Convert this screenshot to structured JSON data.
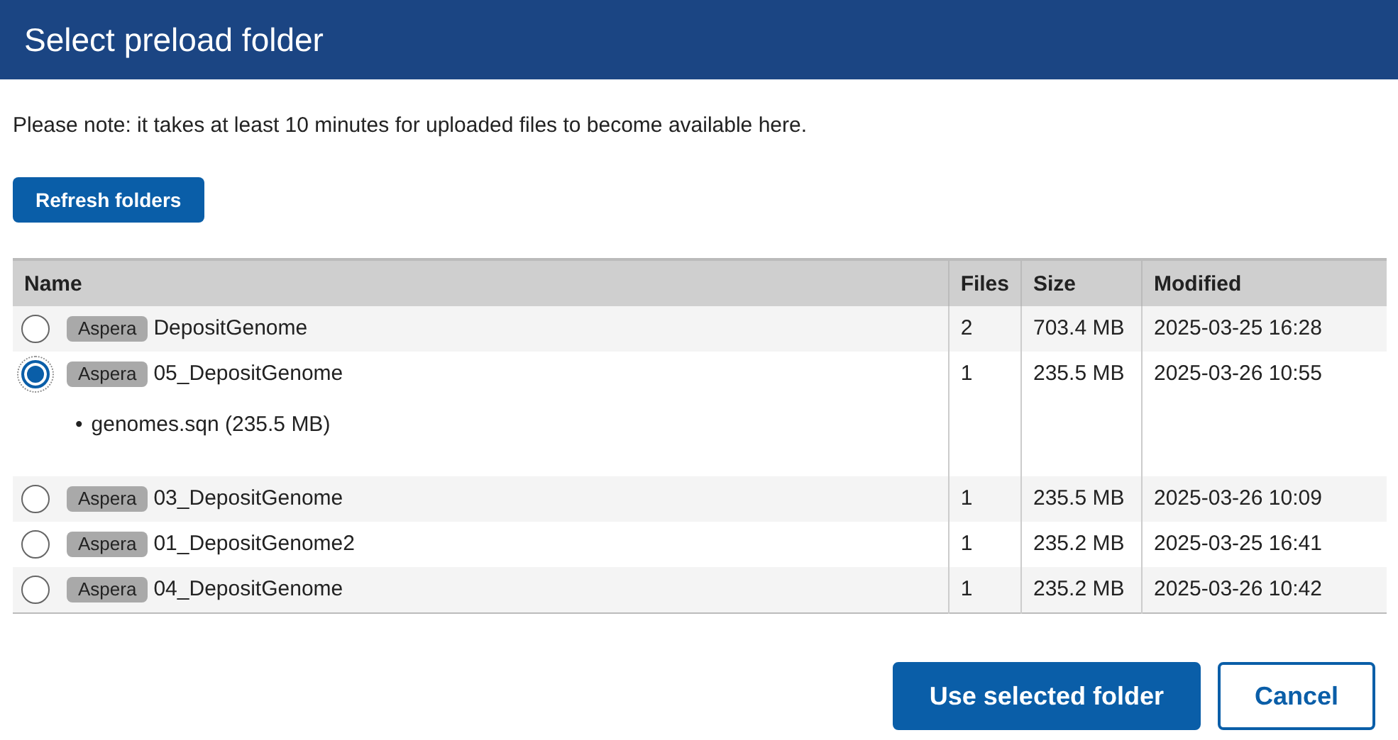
{
  "window": {
    "title": "Select preload folder"
  },
  "note": "Please note: it takes at least 10 minutes for uploaded files to become available here.",
  "refresh_button": "Refresh folders",
  "table": {
    "columns": [
      "Name",
      "Files",
      "Size",
      "Modified"
    ],
    "rows": [
      {
        "selected": false,
        "tag": "Aspera",
        "name": "DepositGenome",
        "files": "2",
        "size": "703.4 MB",
        "modified": "2025-03-25 16:28",
        "children": []
      },
      {
        "selected": true,
        "tag": "Aspera",
        "name": "05_DepositGenome",
        "files": "1",
        "size": "235.5 MB",
        "modified": "2025-03-26 10:55",
        "children": [
          {
            "marker": "•",
            "text": "genomes.sqn (235.5 MB)"
          }
        ]
      },
      {
        "selected": false,
        "tag": "Aspera",
        "name": "03_DepositGenome",
        "files": "1",
        "size": "235.5 MB",
        "modified": "2025-03-26 10:09",
        "children": []
      },
      {
        "selected": false,
        "tag": "Aspera",
        "name": "01_DepositGenome2",
        "files": "1",
        "size": "235.2 MB",
        "modified": "2025-03-25 16:41",
        "children": []
      },
      {
        "selected": false,
        "tag": "Aspera",
        "name": "04_DepositGenome",
        "files": "1",
        "size": "235.2 MB",
        "modified": "2025-03-26 10:42",
        "children": []
      }
    ]
  },
  "buttons": [
    {
      "label": "Use selected folder",
      "kind": "primary"
    },
    {
      "label": "Cancel",
      "kind": "secondary"
    }
  ]
}
